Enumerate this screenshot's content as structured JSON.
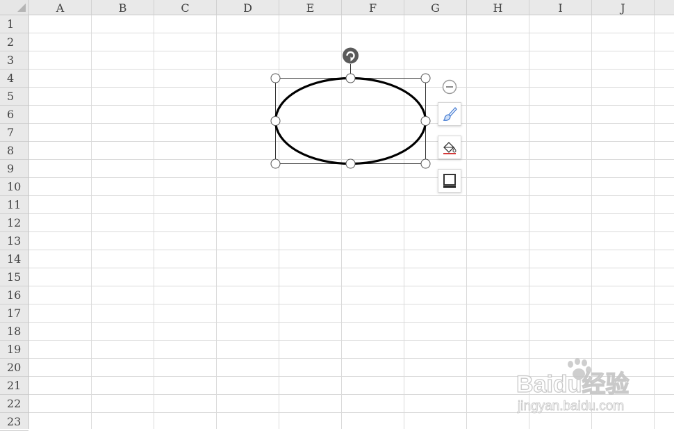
{
  "columns": [
    "A",
    "B",
    "C",
    "D",
    "E",
    "F",
    "G",
    "H",
    "I",
    "J"
  ],
  "rows": [
    "1",
    "2",
    "3",
    "4",
    "5",
    "6",
    "7",
    "8",
    "9",
    "10",
    "11",
    "12",
    "13",
    "14",
    "15",
    "16",
    "17",
    "18",
    "19",
    "20",
    "21",
    "22",
    "23"
  ],
  "shape": {
    "type": "ellipse",
    "selected": true,
    "stroke_color": "#000000",
    "fill": "none"
  },
  "side_toolbar": {
    "buttons": [
      {
        "name": "shape-style",
        "icon": "paintbrush-icon"
      },
      {
        "name": "shape-fill",
        "icon": "paint-bucket-icon"
      },
      {
        "name": "shape-outline",
        "icon": "outline-icon"
      }
    ],
    "collapse_icon": "minus-circle-icon"
  },
  "watermark": {
    "brand": "Baidu经验",
    "url": "jingyan.baidu.com"
  },
  "colors": {
    "header_bg": "#e9e9e9",
    "grid_line": "#dadada",
    "brush_blue": "#4a7fd4",
    "fill_red": "#d43a3a"
  }
}
